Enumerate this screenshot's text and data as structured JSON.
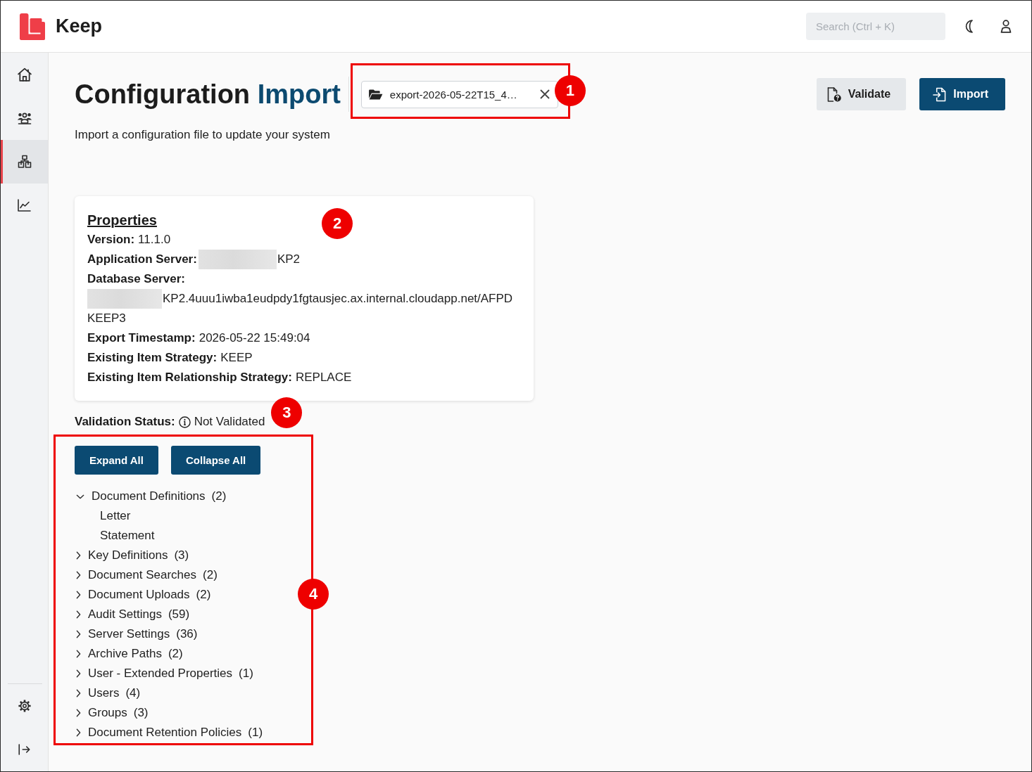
{
  "app": {
    "name": "Keep"
  },
  "header": {
    "search": {
      "placeholder": "Search (Ctrl + K)"
    }
  },
  "sidebar": {
    "items": [
      {
        "kind": "home",
        "selected": false
      },
      {
        "kind": "people",
        "selected": false
      },
      {
        "kind": "hierarchy",
        "selected": true
      },
      {
        "kind": "chart",
        "selected": false
      }
    ],
    "footer_items": [
      {
        "kind": "settings"
      },
      {
        "kind": "exit"
      }
    ]
  },
  "page": {
    "title": [
      {
        "text": "Configuration",
        "accent": false
      },
      {
        "text": "Import",
        "accent": true
      }
    ],
    "subtitle": "Import a configuration file to update your system"
  },
  "file": {
    "name": "export-2026-05-22T15_4…",
    "annotation": {
      "label": "1",
      "boxed": true
    }
  },
  "actions": [
    {
      "label": "Validate",
      "kind": "validate"
    },
    {
      "label": "Import",
      "kind": "import"
    }
  ],
  "properties": {
    "title": "Properties",
    "annotation": {
      "label": "2"
    },
    "items": [
      {
        "label": "Version:",
        "value": "11.1.0",
        "kind": "inline"
      },
      {
        "label": "Application Server:",
        "value": "KP2",
        "kind": "inline",
        "redacted": true
      },
      {
        "label": "Database Server:",
        "value": "KP2.4uuu1iwba1eudpdy1fgtausjec.ax.internal.cloudapp.net/AFPD\nKEEP3",
        "kind": "stacked",
        "redacted": true
      },
      {
        "label": "Export Timestamp:",
        "value": "2026-05-22 15:49:04",
        "kind": "inline"
      },
      {
        "label": "Existing Item Strategy:",
        "value": "KEEP",
        "kind": "inline"
      },
      {
        "label": "Existing Item Relationship Strategy:",
        "value": "REPLACE",
        "kind": "inline"
      }
    ]
  },
  "validation": {
    "label": "Validation Status:",
    "value": "Not Validated",
    "annotation": {
      "label": "3"
    }
  },
  "tree_section": {
    "annotation": {
      "label": "4",
      "boxed": true
    },
    "buttons": [
      "Expand All",
      "Collapse All"
    ],
    "items": [
      {
        "label": "Document Definitions",
        "count": "(2)",
        "expanded": true,
        "children": [
          {
            "label": "Letter"
          },
          {
            "label": "Statement"
          }
        ]
      },
      {
        "label": "Key Definitions",
        "count": "(3)",
        "expanded": false
      },
      {
        "label": "Document Searches",
        "count": "(2)",
        "expanded": false
      },
      {
        "label": "Document Uploads",
        "count": "(2)",
        "expanded": false
      },
      {
        "label": "Audit Settings",
        "count": "(59)",
        "expanded": false
      },
      {
        "label": "Server Settings",
        "count": "(36)",
        "expanded": false
      },
      {
        "label": "Archive Paths",
        "count": "(2)",
        "expanded": false
      },
      {
        "label": "User - Extended Properties",
        "count": "(1)",
        "expanded": false
      },
      {
        "label": "Users",
        "count": "(4)",
        "expanded": false
      },
      {
        "label": "Groups",
        "count": "(3)",
        "expanded": false
      },
      {
        "label": "Document Retention Policies",
        "count": "(1)",
        "expanded": false
      }
    ]
  }
}
